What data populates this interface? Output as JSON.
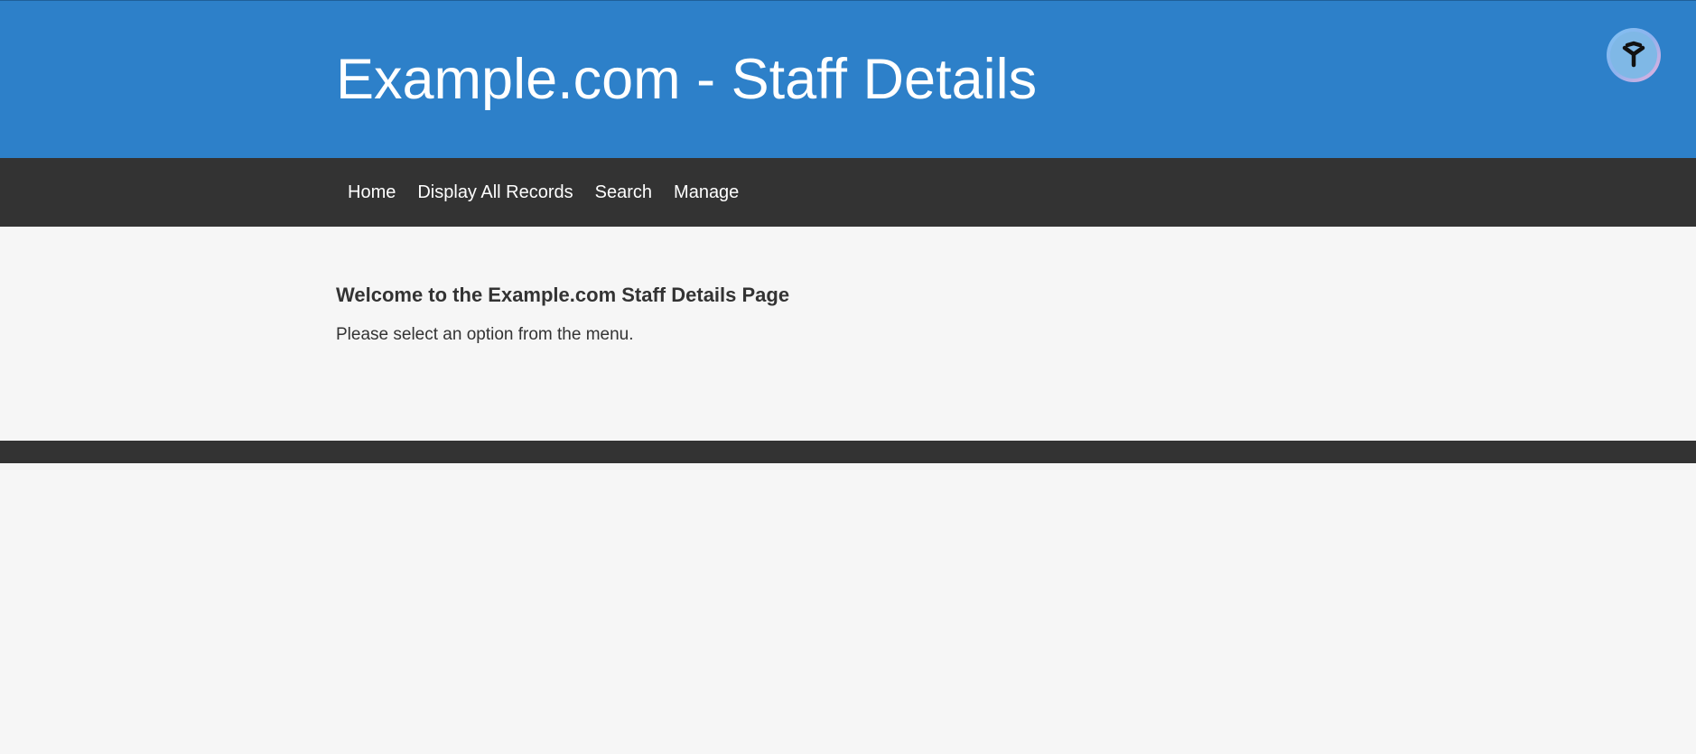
{
  "header": {
    "title": "Example.com - Staff Details",
    "extension_icon": "assistant-badge-icon"
  },
  "nav": {
    "items": [
      {
        "label": "Home"
      },
      {
        "label": "Display All Records"
      },
      {
        "label": "Search"
      },
      {
        "label": "Manage"
      }
    ]
  },
  "main": {
    "heading": "Welcome to the Example.com Staff Details Page",
    "text": "Please select an option from the menu."
  },
  "colors": {
    "header_bg": "#2d80c9",
    "nav_bg": "#333333",
    "page_bg": "#f6f6f6",
    "text": "#333333"
  }
}
